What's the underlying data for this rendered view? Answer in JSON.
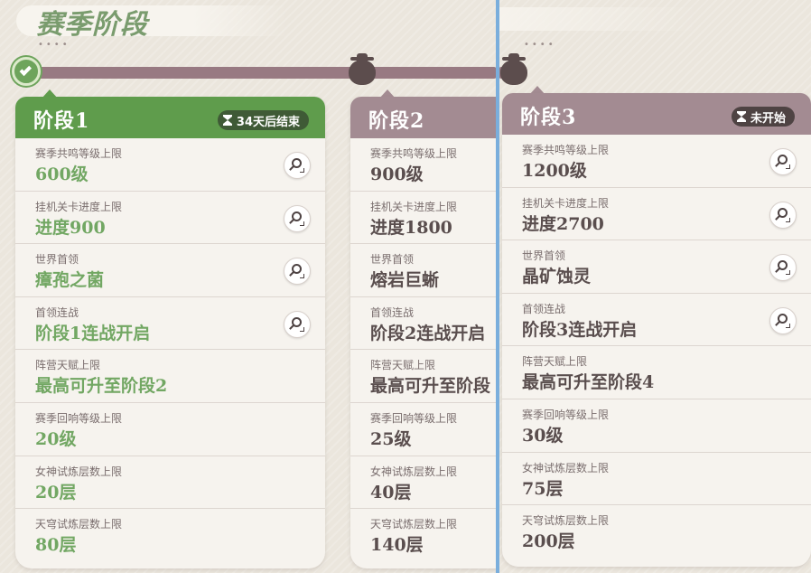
{
  "page_title": "赛季阶段",
  "decor_dots": "••••",
  "colors": {
    "active_green": "#5f9c4c",
    "value_green": "#72a763",
    "locked_mauve": "#a38b92",
    "track": "#987a82",
    "divider": "#7aaedc"
  },
  "stages": [
    {
      "title": "阶段1",
      "status": "34天后结束",
      "state": "active",
      "rows": [
        {
          "label": "赛季共鸣等级上限",
          "value": "600级",
          "has_inspect": true
        },
        {
          "label": "挂机关卡进度上限",
          "value": "进度900",
          "has_inspect": true
        },
        {
          "label": "世界首领",
          "value": "瘴孢之菌",
          "has_inspect": true
        },
        {
          "label": "首领连战",
          "value": "阶段1连战开启",
          "has_inspect": true
        },
        {
          "label": "阵营天赋上限",
          "value": "最高可升至阶段2",
          "has_inspect": false
        },
        {
          "label": "赛季回响等级上限",
          "value": "20级",
          "has_inspect": false
        },
        {
          "label": "女神试炼层数上限",
          "value": "20层",
          "has_inspect": false
        },
        {
          "label": "天穹试炼层数上限",
          "value": "80层",
          "has_inspect": false
        }
      ]
    },
    {
      "title": "阶段2",
      "status": "",
      "state": "locked",
      "rows": [
        {
          "label": "赛季共鸣等级上限",
          "value": "900级"
        },
        {
          "label": "挂机关卡进度上限",
          "value": "进度1800"
        },
        {
          "label": "世界首领",
          "value": "熔岩巨蜥"
        },
        {
          "label": "首领连战",
          "value": "阶段2连战开启"
        },
        {
          "label": "阵营天赋上限",
          "value": "最高可升至阶段"
        },
        {
          "label": "赛季回响等级上限",
          "value": "25级"
        },
        {
          "label": "女神试炼层数上限",
          "value": "40层"
        },
        {
          "label": "天穹试炼层数上限",
          "value": "140层"
        }
      ]
    },
    {
      "title": "阶段3",
      "status": "未开始",
      "state": "locked",
      "rows": [
        {
          "label": "赛季共鸣等级上限",
          "value": "1200级",
          "has_inspect": true
        },
        {
          "label": "挂机关卡进度上限",
          "value": "进度2700",
          "has_inspect": true
        },
        {
          "label": "世界首领",
          "value": "晶矿蚀灵",
          "has_inspect": true
        },
        {
          "label": "首领连战",
          "value": "阶段3连战开启",
          "has_inspect": true
        },
        {
          "label": "阵营天赋上限",
          "value": "最高可升至阶段4",
          "has_inspect": false
        },
        {
          "label": "赛季回响等级上限",
          "value": "30级",
          "has_inspect": false
        },
        {
          "label": "女神试炼层数上限",
          "value": "75层",
          "has_inspect": false
        },
        {
          "label": "天穹试炼层数上限",
          "value": "200层",
          "has_inspect": false
        }
      ]
    }
  ]
}
